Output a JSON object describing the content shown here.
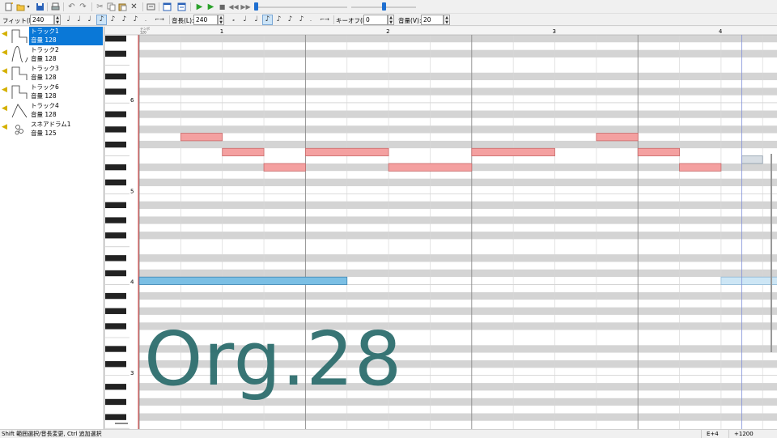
{
  "toolbar1": {
    "icons": [
      "new-file-icon",
      "open-folder-icon",
      "dropdown-icon",
      "save-icon",
      "print-icon",
      "undo-icon",
      "redo-icon",
      "cut-icon",
      "copy-icon",
      "paste-icon",
      "delete-icon",
      "properties-icon",
      "window-icon",
      "window2-icon",
      "play-icon",
      "play-from-icon",
      "stop-icon",
      "rewind-icon",
      "fast-forward-icon"
    ],
    "position_slider_value": 0.0,
    "volume_slider_value": 0.5
  },
  "toolbar2": {
    "fit_label": "フィット(F):",
    "fit_value": "240",
    "note_length_label": "音長(L):",
    "note_length_value": "240",
    "keyoff_label": "キーオフ(K):",
    "keyoff_value": "0",
    "volume_label": "音量(V):",
    "volume_value": "20"
  },
  "tracks": [
    {
      "name": "トラック1",
      "volume": "音量 128",
      "wave": "square",
      "selected": true
    },
    {
      "name": "トラック2",
      "volume": "音量 128",
      "wave": "sine",
      "selected": false
    },
    {
      "name": "トラック3",
      "volume": "音量 128",
      "wave": "square",
      "selected": false
    },
    {
      "name": "トラック6",
      "volume": "音量 128",
      "wave": "square",
      "selected": false
    },
    {
      "name": "トラック4",
      "volume": "音量 128",
      "wave": "triangle",
      "selected": false
    },
    {
      "name": "スネアドラム1",
      "volume": "音量 125",
      "wave": "drum",
      "selected": false
    }
  ],
  "roll": {
    "corner_label": "テンポ\n120",
    "measures": [
      "1",
      "2",
      "3",
      "4"
    ],
    "octave_labels": [
      {
        "label": "6",
        "pitch": 72
      },
      {
        "label": "5",
        "pitch": 60
      },
      {
        "label": "4",
        "pitch": 48
      },
      {
        "label": "3",
        "pitch": 36
      }
    ],
    "top_pitch": 80,
    "colors": {
      "note_red": "#f4a0a0",
      "note_blue": "#7bbfe4",
      "note_light": "#cde6f5",
      "note_gray": "#d7dde3"
    },
    "notes": [
      {
        "start": 1,
        "length": 1,
        "pitch": 67,
        "color": "red"
      },
      {
        "start": 2,
        "length": 1,
        "pitch": 65,
        "color": "red"
      },
      {
        "start": 3,
        "length": 1,
        "pitch": 63,
        "color": "red"
      },
      {
        "start": 4,
        "length": 2,
        "pitch": 65,
        "color": "red"
      },
      {
        "start": 6,
        "length": 2,
        "pitch": 63,
        "color": "red"
      },
      {
        "start": 8,
        "length": 2,
        "pitch": 65,
        "color": "red"
      },
      {
        "start": 11,
        "length": 1,
        "pitch": 67,
        "color": "red"
      },
      {
        "start": 12,
        "length": 1,
        "pitch": 65,
        "color": "red"
      },
      {
        "start": 13,
        "length": 1,
        "pitch": 63,
        "color": "red"
      },
      {
        "start": 0,
        "length": 5,
        "pitch": 48,
        "color": "blue"
      },
      {
        "start": 14,
        "length": 1.4,
        "pitch": 48,
        "color": "light"
      },
      {
        "start": 14.5,
        "length": 0.5,
        "pitch": 64,
        "color": "gray"
      }
    ]
  },
  "watermark": "Org.28",
  "status": {
    "hint": "Shift 範囲選択/音長変更, Ctrl 追加選択",
    "note_readout": "E+4",
    "tick_readout": "+1200"
  }
}
